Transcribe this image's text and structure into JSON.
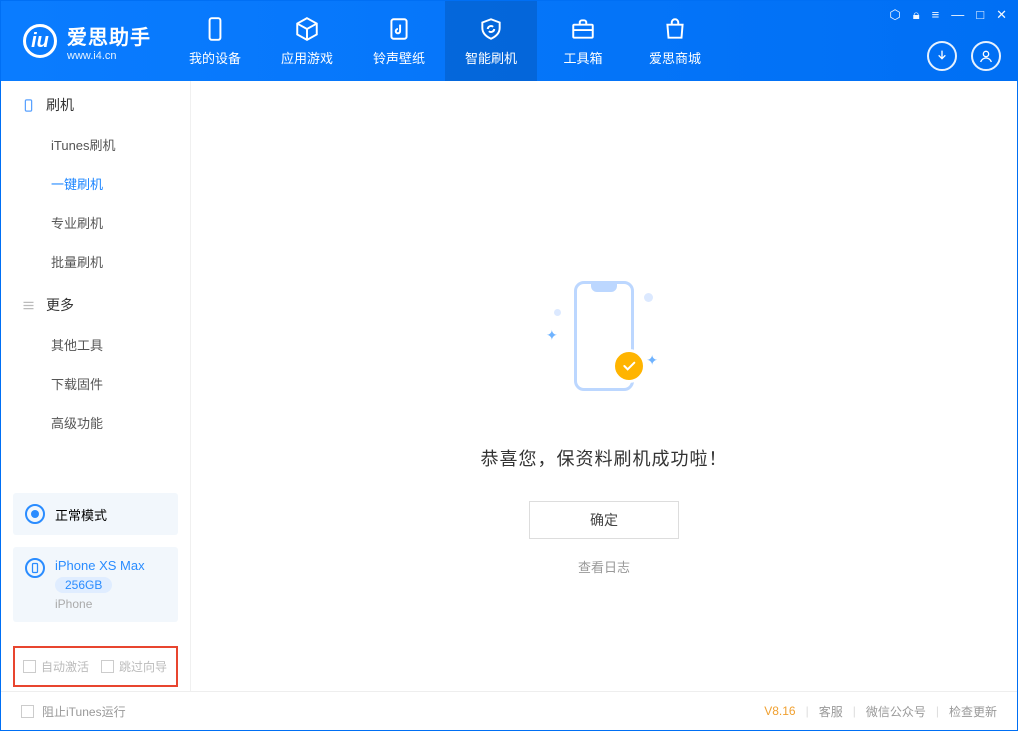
{
  "app": {
    "name_cn": "爱思助手",
    "name_en": "www.i4.cn"
  },
  "nav": [
    {
      "id": "device",
      "label": "我的设备"
    },
    {
      "id": "apps",
      "label": "应用游戏"
    },
    {
      "id": "ring",
      "label": "铃声壁纸"
    },
    {
      "id": "flash",
      "label": "智能刷机",
      "active": true
    },
    {
      "id": "tools",
      "label": "工具箱"
    },
    {
      "id": "store",
      "label": "爱思商城"
    }
  ],
  "sidebar": {
    "group1": {
      "title": "刷机",
      "items": [
        {
          "id": "itunes",
          "label": "iTunes刷机"
        },
        {
          "id": "onekey",
          "label": "一键刷机",
          "active": true
        },
        {
          "id": "pro",
          "label": "专业刷机"
        },
        {
          "id": "batch",
          "label": "批量刷机"
        }
      ]
    },
    "group2": {
      "title": "更多",
      "items": [
        {
          "id": "other",
          "label": "其他工具"
        },
        {
          "id": "fw",
          "label": "下载固件"
        },
        {
          "id": "adv",
          "label": "高级功能"
        }
      ]
    },
    "mode": {
      "label": "正常模式"
    },
    "device": {
      "name": "iPhone XS Max",
      "capacity": "256GB",
      "type": "iPhone"
    },
    "opts": {
      "auto_activate": "自动激活",
      "skip_guide": "跳过向导"
    }
  },
  "content": {
    "success_msg": "恭喜您，保资料刷机成功啦！",
    "ok": "确定",
    "view_log": "查看日志"
  },
  "footer": {
    "block_itunes": "阻止iTunes运行",
    "version": "V8.16",
    "support": "客服",
    "wechat": "微信公众号",
    "update": "检查更新"
  }
}
